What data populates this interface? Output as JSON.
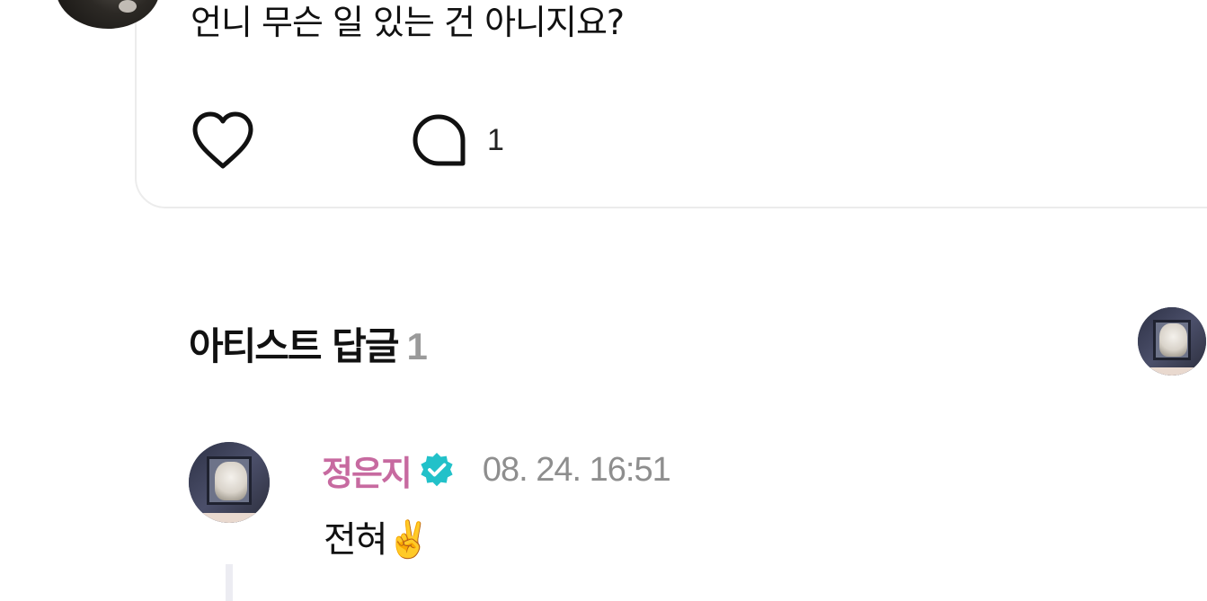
{
  "post": {
    "text": "언니 무슨 일 있는 건 아니지요?",
    "like_icon": "heart-outline-icon",
    "comment_icon": "speech-bubble-outline-icon",
    "comment_count": "1"
  },
  "artist_replies": {
    "title": "아티스트 답글",
    "count": "1"
  },
  "reply": {
    "author": "정은지",
    "verified_icon": "verified-badge-icon",
    "timestamp": "08. 24. 16:51",
    "text": "전혀",
    "emoji": "✌️"
  },
  "colors": {
    "author_name": "#c76aa0",
    "verified_badge": "#22c1c9",
    "timestamp": "#8e8e8e",
    "section_count": "#9a9a9a",
    "card_border": "#ececec"
  }
}
